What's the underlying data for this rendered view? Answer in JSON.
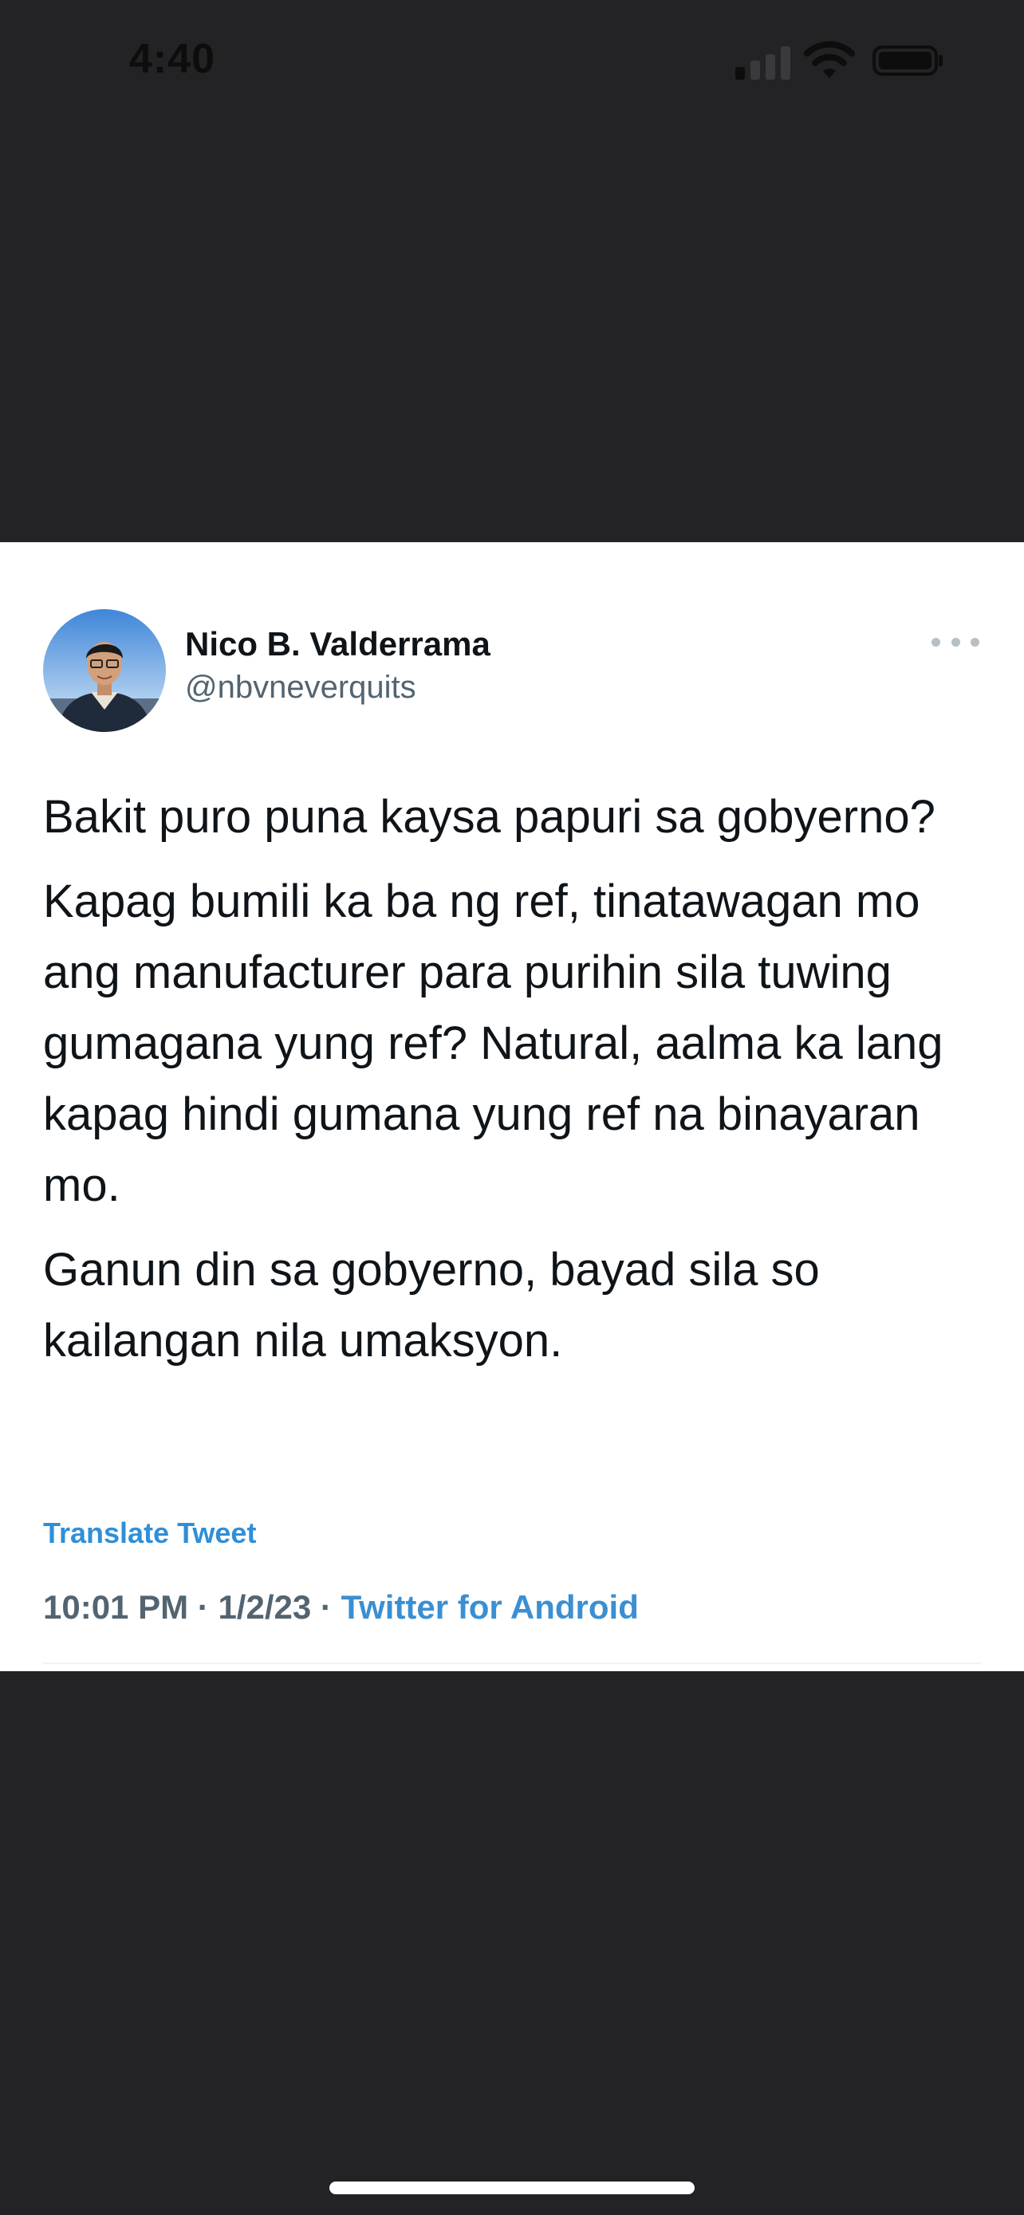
{
  "status_bar": {
    "time": "4:40"
  },
  "tweet": {
    "author": {
      "display_name": "Nico B. Valderrama",
      "handle": "@nbvneverquits"
    },
    "paragraphs": [
      "Bakit puro puna kaysa papuri sa gobyerno?",
      "Kapag bumili ka ba ng ref, tinatawagan mo ang manufacturer para purihin sila tuwing gumagana yung ref? Natural, aalma ka lang kapag hindi gumana yung ref na binayaran mo.",
      "Ganun din sa gobyerno, bayad sila so kailangan nila umaksyon."
    ],
    "translate_label": "Translate Tweet",
    "time": "10:01 PM",
    "date": "1/2/23",
    "separator": "·",
    "source": "Twitter for Android"
  },
  "icons": {
    "signal": "signal-icon",
    "wifi": "wifi-icon",
    "battery": "battery-icon",
    "more": "more-horizontal-icon",
    "avatar": "avatar"
  },
  "colors": {
    "background": "#232325",
    "card": "#ffffff",
    "link": "#2f8fd8",
    "secondary_text": "#536471"
  }
}
